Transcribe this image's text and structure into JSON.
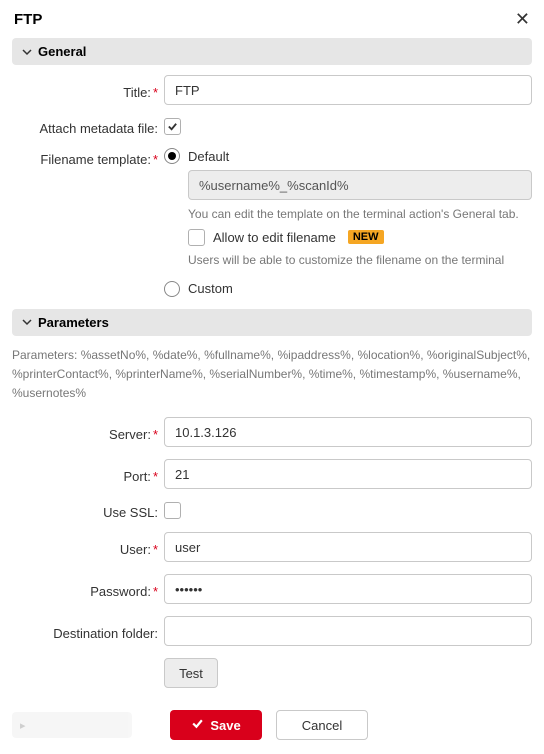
{
  "title": "FTP",
  "sections": {
    "general": "General",
    "parameters": "Parameters"
  },
  "labels": {
    "title": "Title:",
    "attach_metadata": "Attach metadata file:",
    "filename_template": "Filename template:",
    "server": "Server:",
    "port": "Port:",
    "use_ssl": "Use SSL:",
    "user": "User:",
    "password": "Password:",
    "destination_folder": "Destination folder:"
  },
  "values": {
    "title": "FTP",
    "attach_metadata_checked": true,
    "template_mode": "default",
    "template_pattern": "%username%_%scanId%",
    "allow_edit_filename": false,
    "server": "10.1.3.126",
    "port": "21",
    "use_ssl": false,
    "user": "user",
    "password": "••••••",
    "destination_folder": ""
  },
  "radio": {
    "default": "Default",
    "custom": "Custom",
    "allow_edit": "Allow to edit filename"
  },
  "help": {
    "template_edit": "You can edit the template on the terminal action's General tab.",
    "allow_edit": "Users will be able to customize the filename on the terminal"
  },
  "badges": {
    "new": "NEW"
  },
  "params_help": "Parameters: %assetNo%, %date%, %fullname%, %ipaddress%, %location%, %originalSubject%, %printerContact%, %printerName%, %serialNumber%, %time%, %timestamp%, %username%, %usernotes%",
  "buttons": {
    "test": "Test",
    "save": "Save",
    "cancel": "Cancel"
  }
}
